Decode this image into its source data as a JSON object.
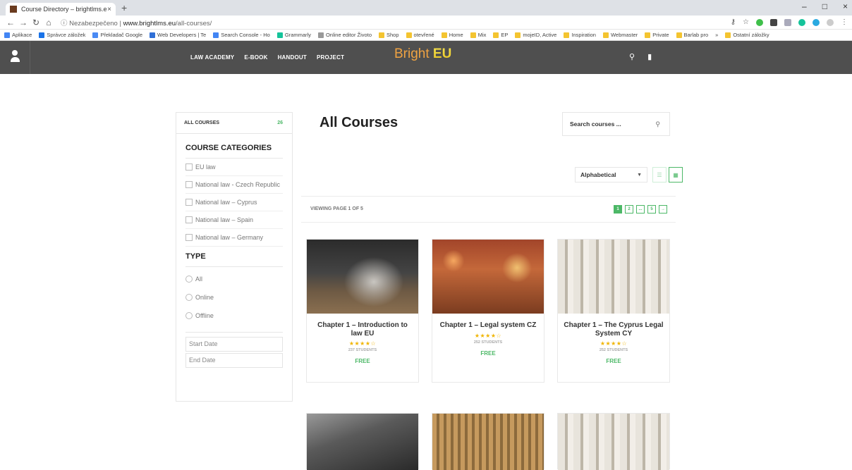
{
  "browser": {
    "tab_title": "Course Directory – brightlms.eu",
    "tab_close": "×",
    "new_tab": "+",
    "window_controls": [
      "–",
      "□",
      "×"
    ],
    "url_security": "Nezabezpečeno",
    "url_host": "www.brightlms.eu",
    "url_path": "/all-courses/",
    "bookmarks": [
      {
        "label": "Aplikace",
        "color": "#4285f4"
      },
      {
        "label": "Správce záložek",
        "color": "#1a73e8"
      },
      {
        "label": "Překladač Google",
        "color": "#4a8af4"
      },
      {
        "label": "Web Developers | Te",
        "color": "#2f6fd6"
      },
      {
        "label": "Search Console - Ho",
        "color": "#4285f4"
      },
      {
        "label": "Grammarly",
        "color": "#15c39a"
      },
      {
        "label": "Online editor Životo",
        "color": "#999999"
      },
      {
        "label": "Shop",
        "color": "#f4c430"
      },
      {
        "label": "otevřené",
        "color": "#f4c430"
      },
      {
        "label": "Home",
        "color": "#f4c430"
      },
      {
        "label": "Mix",
        "color": "#f4c430"
      },
      {
        "label": "EP",
        "color": "#f4c430"
      },
      {
        "label": "mojeID, Active",
        "color": "#f4c430"
      },
      {
        "label": "Inspiration",
        "color": "#f4c430"
      },
      {
        "label": "Webmaster",
        "color": "#f4c430"
      },
      {
        "label": "Private",
        "color": "#f4c430"
      },
      {
        "label": "Barlab pro",
        "color": "#f4c430"
      },
      {
        "label": "»",
        "color": ""
      },
      {
        "label": "Ostatní záložky",
        "color": "#f4c430"
      }
    ]
  },
  "header": {
    "nav": [
      "LAW ACADEMY",
      "E-BOOK",
      "HANDOUT",
      "PROJECT"
    ],
    "logo_bright": "Bright",
    "logo_eu": "EU",
    "search_icon": "search-icon",
    "cart_icon": "cart-icon"
  },
  "sidebar": {
    "all_courses_label": "ALL COURSES",
    "all_courses_count": "26",
    "categories_title": "COURSE CATEGORIES",
    "categories": [
      "EU law",
      "National law - Czech Republic",
      "National law – Cyprus",
      "National law – Spain",
      "National law – Germany"
    ],
    "type_title": "TYPE",
    "types": [
      "All",
      "Online",
      "Offline"
    ],
    "start_date_placeholder": "Start Date",
    "end_date_placeholder": "End Date"
  },
  "main": {
    "title": "All Courses",
    "search_placeholder": "Search courses ...",
    "sort_value": "Alphabetical",
    "viewing_text": "VIEWING PAGE 1 OF 5",
    "pages": [
      "1",
      "2",
      "...",
      "5",
      "→"
    ],
    "courses": [
      {
        "title": "Chapter 1 – Introduction to law EU",
        "stars": "★★★★☆",
        "students": "237 STUDENTS",
        "price": "FREE"
      },
      {
        "title": "Chapter 1 – Legal system CZ",
        "stars": "★★★★☆",
        "students": "252 STUDENTS",
        "price": "FREE"
      },
      {
        "title": "Chapter 1 – The Cyprus Legal System CY",
        "stars": "★★★★☆",
        "students": "252 STUDENTS",
        "price": "FREE"
      }
    ]
  },
  "colors": {
    "accent_green": "#4cb867",
    "header_bg": "#4f4f4f",
    "logo_orange": "#f0a342",
    "star_gold": "#f0b400"
  }
}
